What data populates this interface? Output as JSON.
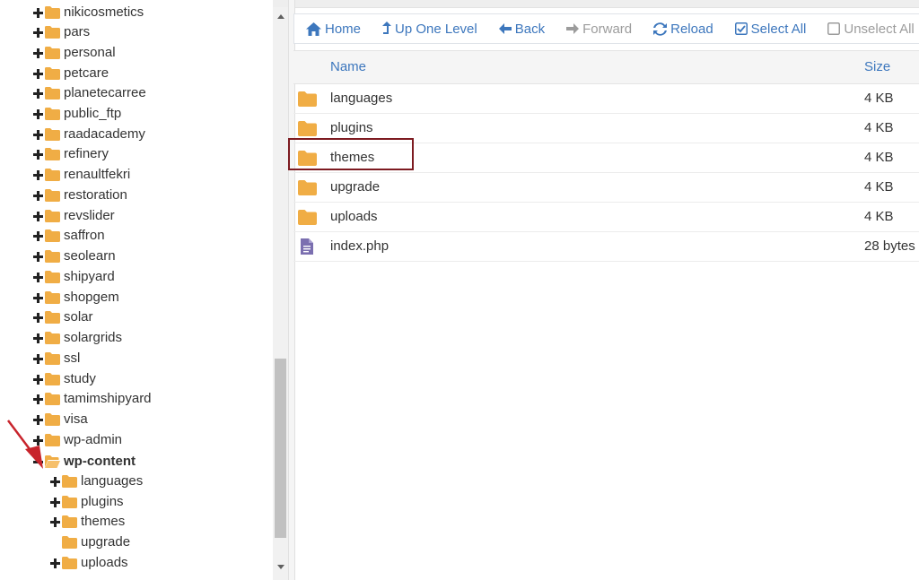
{
  "tree": {
    "items": [
      {
        "label": "nikicosmetics",
        "expanded": false
      },
      {
        "label": "pars",
        "expanded": false
      },
      {
        "label": "personal",
        "expanded": false
      },
      {
        "label": "petcare",
        "expanded": false
      },
      {
        "label": "planetecarree",
        "expanded": false
      },
      {
        "label": "public_ftp",
        "expanded": false
      },
      {
        "label": "raadacademy",
        "expanded": false
      },
      {
        "label": "refinery",
        "expanded": false
      },
      {
        "label": "renaultfekri",
        "expanded": false
      },
      {
        "label": "restoration",
        "expanded": false
      },
      {
        "label": "revslider",
        "expanded": false
      },
      {
        "label": "saffron",
        "expanded": false
      },
      {
        "label": "seolearn",
        "expanded": false
      },
      {
        "label": "shipyard",
        "expanded": false
      },
      {
        "label": "shopgem",
        "expanded": false
      },
      {
        "label": "solar",
        "expanded": false
      },
      {
        "label": "solargrids",
        "expanded": false
      },
      {
        "label": "ssl",
        "expanded": false
      },
      {
        "label": "study",
        "expanded": false
      },
      {
        "label": "tamimshipyard",
        "expanded": false
      },
      {
        "label": "visa",
        "expanded": false
      },
      {
        "label": "wp-admin",
        "expanded": false
      },
      {
        "label": "wp-content",
        "expanded": true,
        "selected": true
      },
      {
        "label": "languages",
        "expanded": false
      },
      {
        "label": "plugins",
        "expanded": false
      },
      {
        "label": "themes",
        "expanded": false
      },
      {
        "label": "upgrade",
        "expanded": null
      },
      {
        "label": "uploads",
        "expanded": false
      }
    ]
  },
  "toolbar": {
    "home": "Home",
    "up_one_level": "Up One Level",
    "back": "Back",
    "forward": "Forward",
    "reload": "Reload",
    "select_all": "Select All",
    "unselect_all": "Unselect All"
  },
  "table": {
    "headers": {
      "name": "Name",
      "size": "Size"
    },
    "rows": [
      {
        "name": "languages",
        "size": "4 KB",
        "type": "folder"
      },
      {
        "name": "plugins",
        "size": "4 KB",
        "type": "folder"
      },
      {
        "name": "themes",
        "size": "4 KB",
        "type": "folder"
      },
      {
        "name": "upgrade",
        "size": "4 KB",
        "type": "folder"
      },
      {
        "name": "uploads",
        "size": "4 KB",
        "type": "folder"
      },
      {
        "name": "index.php",
        "size": "28 bytes",
        "type": "file"
      }
    ]
  },
  "colors": {
    "link": "#3d77bd",
    "disabled": "#9c9c9c",
    "folder": "#f0ad45",
    "file": "#7b6fb0",
    "highlight": "#7d1b21",
    "arrow": "#c8242c"
  },
  "icons": {
    "home": "home-icon",
    "up": "level-up-icon",
    "back": "arrow-left-icon",
    "forward": "arrow-right-icon",
    "reload": "reload-icon",
    "select": "checkbox-checked-icon",
    "unselect": "checkbox-empty-icon",
    "folder": "folder-icon",
    "file": "file-icon",
    "expand": "plus-icon",
    "collapse": "minus-icon"
  }
}
